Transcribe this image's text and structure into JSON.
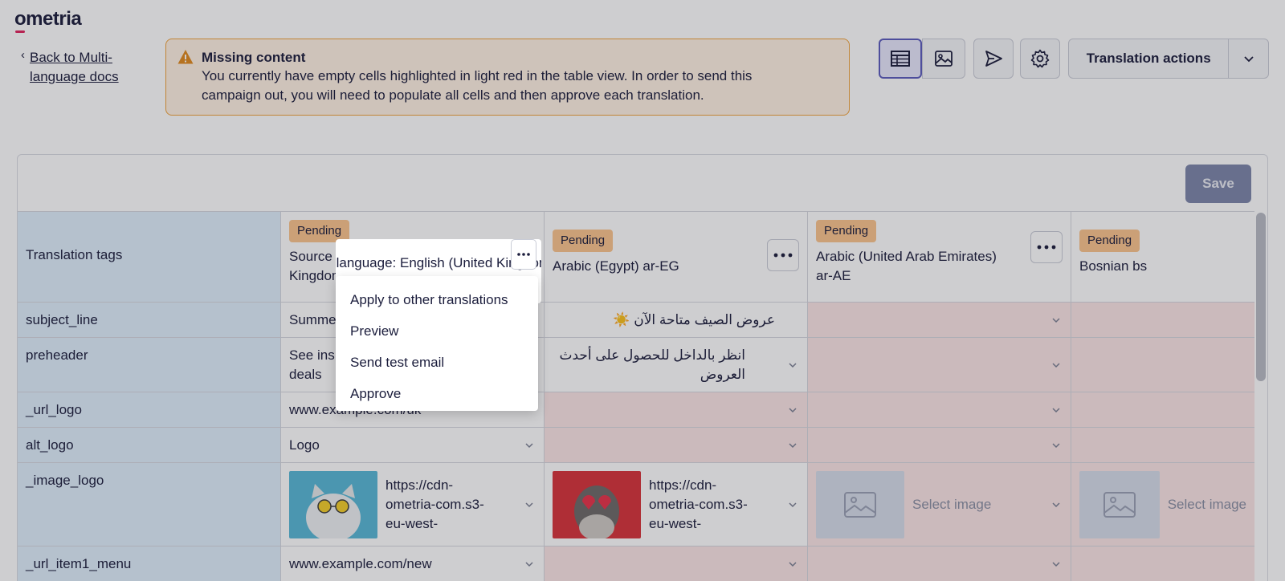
{
  "app": {
    "logo": "ometria"
  },
  "nav": {
    "back_chevron": "‹",
    "back_label": "Back to Multi-language docs"
  },
  "alert": {
    "title": "Missing content",
    "body": "You currently have empty cells highlighted in light red in the table view. In order to send this campaign out, you will need to populate all cells and then approve each translation.",
    "icon": "warning-icon"
  },
  "toolbar": {
    "actions_label": "Translation actions",
    "save_label": "Save"
  },
  "table": {
    "tags_header": "Translation tags",
    "columns": [
      {
        "status": "Pending",
        "title": "Source language: English (United Kingdom)",
        "title_visible": "Kingdo"
      },
      {
        "status": "Pending",
        "title": "Arabic (Egypt) ar-EG"
      },
      {
        "status": "Pending",
        "title": "Arabic (United Arab Emirates) ar-AE"
      },
      {
        "status": "Pending",
        "title": "Bosnian bs"
      }
    ],
    "rows": [
      {
        "tag": "subject_line",
        "cells": [
          "Summe",
          "عروض الصيف متاحة الآن ☀️",
          "",
          ""
        ]
      },
      {
        "tag": "preheader",
        "cells": [
          "See ins deals",
          "انظر بالداخل للحصول على أحدث العروض",
          "",
          ""
        ]
      },
      {
        "tag": "_url_logo",
        "cells": [
          "www.example.com/uk",
          "",
          "",
          ""
        ]
      },
      {
        "tag": "alt_logo",
        "cells": [
          "Logo",
          "",
          "",
          ""
        ]
      },
      {
        "tag": "_image_logo",
        "cells": [
          "https://cdn-ometria-com.s3-eu-west-",
          "https://cdn-ometria-com.s3-eu-west-",
          "Select image",
          "Select image"
        ]
      },
      {
        "tag": "_url_item1_menu",
        "cells": [
          "www.example.com/new",
          "",
          "",
          ""
        ]
      }
    ]
  },
  "context_menu": {
    "header_text": "language: English (United",
    "items": [
      "Apply to other translations",
      "Preview",
      "Send test email",
      "Approve"
    ]
  },
  "colors": {
    "pending": "#fbc58d",
    "empty_cell": "#fbe6e6",
    "tag_column": "#dfeffc",
    "accent": "#5b5bbd"
  }
}
